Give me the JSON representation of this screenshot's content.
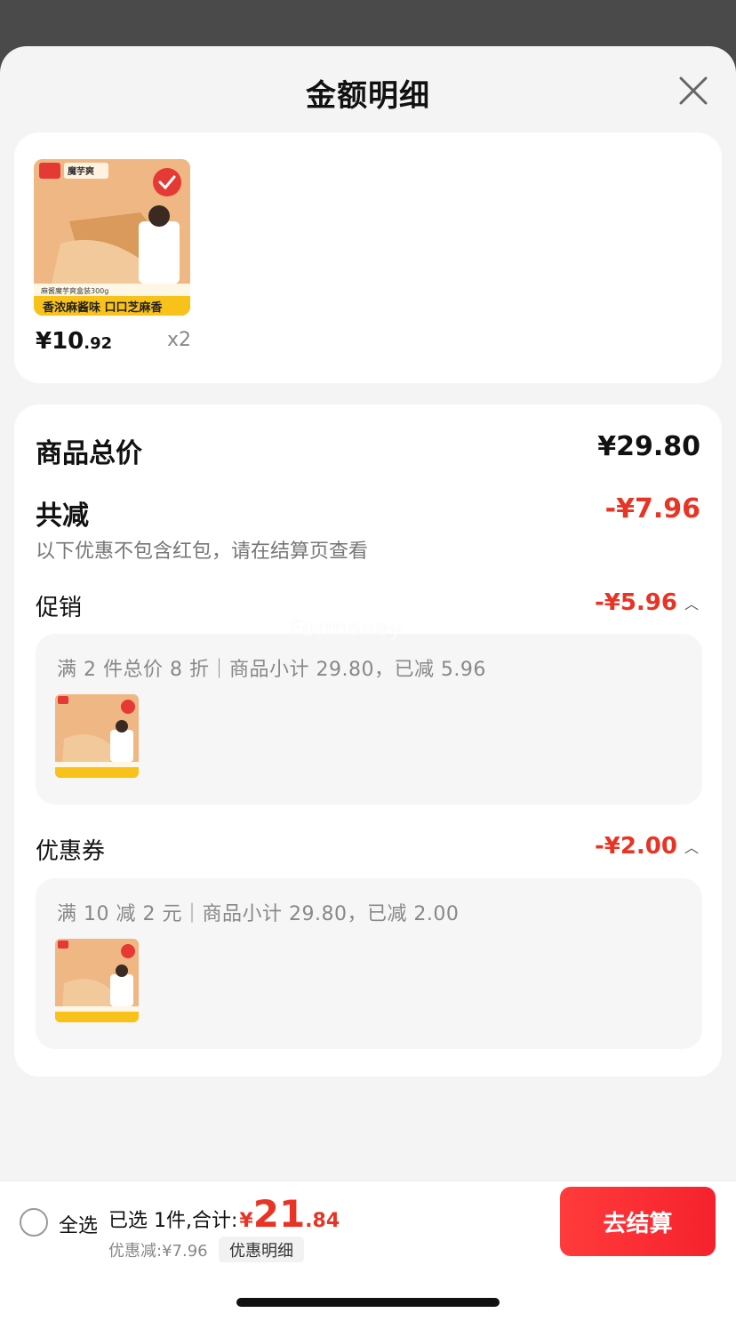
{
  "sheet": {
    "title": "金额明细"
  },
  "product": {
    "thumb_label": "麻酱魔芋爽盒装300g",
    "thumb_banner": "香浓麻酱味 口口芝麻香",
    "thumb_brand": "魔芋爽",
    "price_int": "¥10",
    "price_dec": ".92",
    "qty": "x2"
  },
  "breakdown": {
    "total_label": "商品总价",
    "total_value": "¥29.80",
    "discount_label": "共减",
    "discount_value": "-¥7.96",
    "note": "以下优惠不包含红包，请在结算页查看",
    "promo": {
      "label": "促销",
      "value": "-¥5.96",
      "desc": "满 2 件总价 8 折｜商品小计 29.80，已减 5.96"
    },
    "coupon": {
      "label": "优惠券",
      "value": "-¥2.00",
      "desc": "满 10 减 2 元｜商品小计 29.80，已减 2.00"
    }
  },
  "watermark": "Formoney",
  "footer": {
    "select_all": "全选",
    "selected_text": "已选 1件,合计:",
    "total_yen": "¥",
    "total_int": "21",
    "total_dec": ".84",
    "discount_text": "优惠减:¥7.96",
    "detail_chip": "优惠明细",
    "checkout": "去结算"
  },
  "colors": {
    "accent": "#e83425",
    "button": "#f5222d"
  }
}
